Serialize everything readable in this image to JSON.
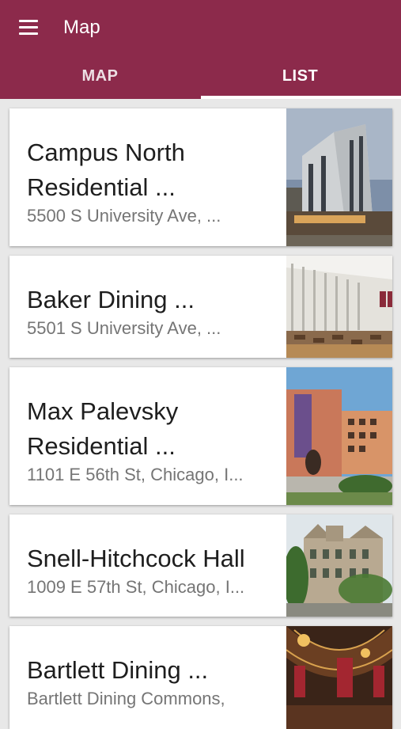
{
  "app": {
    "title": "Map"
  },
  "tabs": [
    {
      "label": "MAP",
      "selected": false
    },
    {
      "label": "LIST",
      "selected": true
    }
  ],
  "icons": {
    "menu": "menu-icon"
  },
  "colors": {
    "primary": "#8c2a4b",
    "indicator": "#ffffff"
  },
  "list": [
    {
      "name_line1": "Campus North",
      "name_line2": "Residential ...",
      "address": "5500 S University Ave, ..."
    },
    {
      "name_line1": "Baker Dining ...",
      "address": "5501 S University Ave, ..."
    },
    {
      "name_line1": "Max Palevsky",
      "name_line2": "Residential ...",
      "address": "1101 E 56th St, Chicago, I..."
    },
    {
      "name_line1": "Snell-Hitchcock Hall",
      "address": "1009 E 57th St, Chicago, I..."
    },
    {
      "name_line1": "Bartlett Dining ...",
      "address": "Bartlett Dining Commons,"
    }
  ]
}
